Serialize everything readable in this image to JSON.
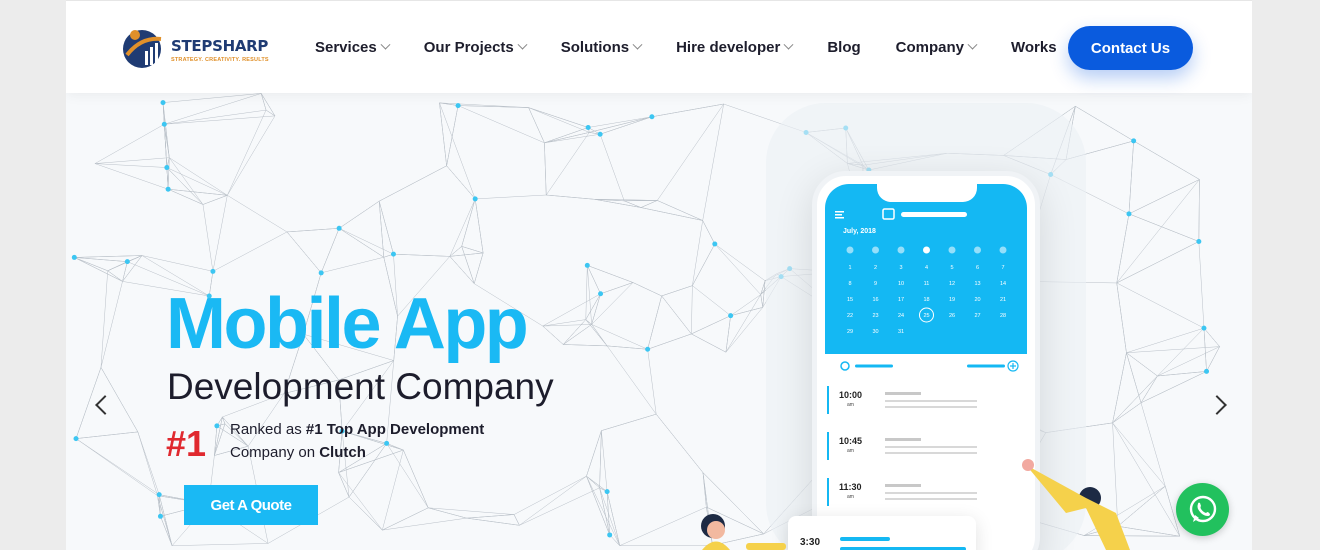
{
  "brand": {
    "name_part1": "STEP",
    "name_part2": "SHARP",
    "tagline": "STRATEGY. CREATIVITY. RESULTS"
  },
  "nav": {
    "items": [
      {
        "label": "Services",
        "dropdown": true
      },
      {
        "label": "Our Projects",
        "dropdown": true
      },
      {
        "label": "Solutions",
        "dropdown": true
      },
      {
        "label": "Hire developer",
        "dropdown": true
      },
      {
        "label": "Blog",
        "dropdown": false
      },
      {
        "label": "Company",
        "dropdown": true
      },
      {
        "label": "Works",
        "dropdown": false
      }
    ],
    "contact_label": "Contact Us"
  },
  "hero": {
    "title_line1": "Mobile App",
    "title_line2": "Development Company",
    "rank_number": "#1",
    "rank_text_prefix": "Ranked as ",
    "rank_text_bold1": "#1 Top App Development",
    "rank_text_mid": "Company on ",
    "rank_text_bold2": "Clutch",
    "cta_label": "Get A Quote"
  },
  "phone": {
    "month": "July, 2018",
    "weekday_count": 7,
    "days": [
      "1",
      "2",
      "3",
      "4",
      "5",
      "6",
      "7",
      "8",
      "9",
      "10",
      "11",
      "12",
      "13",
      "14",
      "15",
      "16",
      "17",
      "18",
      "19",
      "20",
      "21",
      "22",
      "23",
      "24",
      "25",
      "26",
      "27",
      "28",
      "29",
      "30",
      "31"
    ],
    "selected_day": "25",
    "times": [
      {
        "time": "10:00",
        "ampm": "am"
      },
      {
        "time": "10:45",
        "ampm": "am"
      },
      {
        "time": "11:30",
        "ampm": "am"
      }
    ],
    "card_time": "3:30"
  },
  "colors": {
    "accent": "#1ab9f4",
    "primary_button": "#0a5bde",
    "rank_red": "#e0292f",
    "whatsapp": "#22c15e"
  }
}
